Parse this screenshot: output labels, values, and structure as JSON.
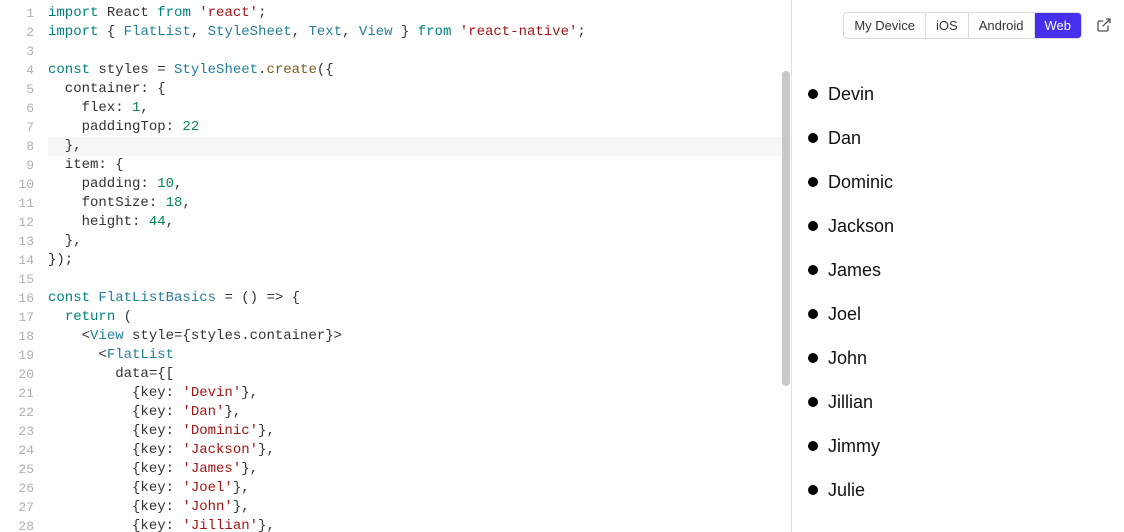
{
  "editor": {
    "lines": [
      {
        "n": 1,
        "tokens": [
          [
            "kw",
            "import"
          ],
          [
            "",
            " React "
          ],
          [
            "kw",
            "from"
          ],
          [
            "",
            " "
          ],
          [
            "str",
            "'react'"
          ],
          [
            "",
            ";"
          ]
        ]
      },
      {
        "n": 2,
        "tokens": [
          [
            "kw",
            "import"
          ],
          [
            "",
            " { "
          ],
          [
            "cls",
            "FlatList"
          ],
          [
            "",
            ", "
          ],
          [
            "cls",
            "StyleSheet"
          ],
          [
            "",
            ", "
          ],
          [
            "cls",
            "Text"
          ],
          [
            "",
            ", "
          ],
          [
            "cls",
            "View"
          ],
          [
            "",
            " } "
          ],
          [
            "kw",
            "from"
          ],
          [
            "",
            " "
          ],
          [
            "str",
            "'react-native'"
          ],
          [
            "",
            ";"
          ]
        ]
      },
      {
        "n": 3,
        "tokens": []
      },
      {
        "n": 4,
        "tokens": [
          [
            "kw",
            "const"
          ],
          [
            "",
            " styles = "
          ],
          [
            "cls",
            "StyleSheet"
          ],
          [
            "",
            "."
          ],
          [
            "fn",
            "create"
          ],
          [
            "",
            "({"
          ]
        ]
      },
      {
        "n": 5,
        "tokens": [
          [
            "",
            "  container: {"
          ]
        ]
      },
      {
        "n": 6,
        "tokens": [
          [
            "",
            "    flex: "
          ],
          [
            "num2",
            "1"
          ],
          [
            "",
            ","
          ]
        ]
      },
      {
        "n": 7,
        "tokens": [
          [
            "",
            "    paddingTop: "
          ],
          [
            "num2",
            "22"
          ]
        ]
      },
      {
        "n": 8,
        "active": true,
        "tokens": [
          [
            "",
            "  },"
          ]
        ]
      },
      {
        "n": 9,
        "tokens": [
          [
            "",
            "  item: {"
          ]
        ]
      },
      {
        "n": 10,
        "tokens": [
          [
            "",
            "    padding: "
          ],
          [
            "num2",
            "10"
          ],
          [
            "",
            ","
          ]
        ]
      },
      {
        "n": 11,
        "tokens": [
          [
            "",
            "    fontSize: "
          ],
          [
            "num2",
            "18"
          ],
          [
            "",
            ","
          ]
        ]
      },
      {
        "n": 12,
        "tokens": [
          [
            "",
            "    height: "
          ],
          [
            "num2",
            "44"
          ],
          [
            "",
            ","
          ]
        ]
      },
      {
        "n": 13,
        "tokens": [
          [
            "",
            "  },"
          ]
        ]
      },
      {
        "n": 14,
        "tokens": [
          [
            "",
            "});"
          ]
        ]
      },
      {
        "n": 15,
        "tokens": []
      },
      {
        "n": 16,
        "tokens": [
          [
            "kw",
            "const"
          ],
          [
            "",
            " "
          ],
          [
            "cls",
            "FlatListBasics"
          ],
          [
            "",
            " = () => {"
          ]
        ]
      },
      {
        "n": 17,
        "tokens": [
          [
            "",
            "  "
          ],
          [
            "kw",
            "return"
          ],
          [
            "",
            " ("
          ]
        ]
      },
      {
        "n": 18,
        "tokens": [
          [
            "",
            "    <"
          ],
          [
            "cls",
            "View"
          ],
          [
            "",
            " style={styles.container}>"
          ]
        ]
      },
      {
        "n": 19,
        "tokens": [
          [
            "",
            "      <"
          ],
          [
            "cls",
            "FlatList"
          ]
        ]
      },
      {
        "n": 20,
        "tokens": [
          [
            "",
            "        data={["
          ]
        ]
      },
      {
        "n": 21,
        "tokens": [
          [
            "",
            "          {key: "
          ],
          [
            "str",
            "'Devin'"
          ],
          [
            "",
            "},"
          ]
        ]
      },
      {
        "n": 22,
        "tokens": [
          [
            "",
            "          {key: "
          ],
          [
            "str",
            "'Dan'"
          ],
          [
            "",
            "},"
          ]
        ]
      },
      {
        "n": 23,
        "tokens": [
          [
            "",
            "          {key: "
          ],
          [
            "str",
            "'Dominic'"
          ],
          [
            "",
            "},"
          ]
        ]
      },
      {
        "n": 24,
        "tokens": [
          [
            "",
            "          {key: "
          ],
          [
            "str",
            "'Jackson'"
          ],
          [
            "",
            "},"
          ]
        ]
      },
      {
        "n": 25,
        "tokens": [
          [
            "",
            "          {key: "
          ],
          [
            "str",
            "'James'"
          ],
          [
            "",
            "},"
          ]
        ]
      },
      {
        "n": 26,
        "tokens": [
          [
            "",
            "          {key: "
          ],
          [
            "str",
            "'Joel'"
          ],
          [
            "",
            "},"
          ]
        ]
      },
      {
        "n": 27,
        "tokens": [
          [
            "",
            "          {key: "
          ],
          [
            "str",
            "'John'"
          ],
          [
            "",
            "},"
          ]
        ]
      },
      {
        "n": 28,
        "tokens": [
          [
            "",
            "          {key: "
          ],
          [
            "str",
            "'Jillian'"
          ],
          [
            "",
            "},"
          ]
        ]
      }
    ]
  },
  "preview": {
    "tabs": [
      {
        "label": "My Device",
        "active": false
      },
      {
        "label": "iOS",
        "active": false
      },
      {
        "label": "Android",
        "active": false
      },
      {
        "label": "Web",
        "active": true
      }
    ],
    "items": [
      "Devin",
      "Dan",
      "Dominic",
      "Jackson",
      "James",
      "Joel",
      "John",
      "Jillian",
      "Jimmy",
      "Julie"
    ]
  }
}
